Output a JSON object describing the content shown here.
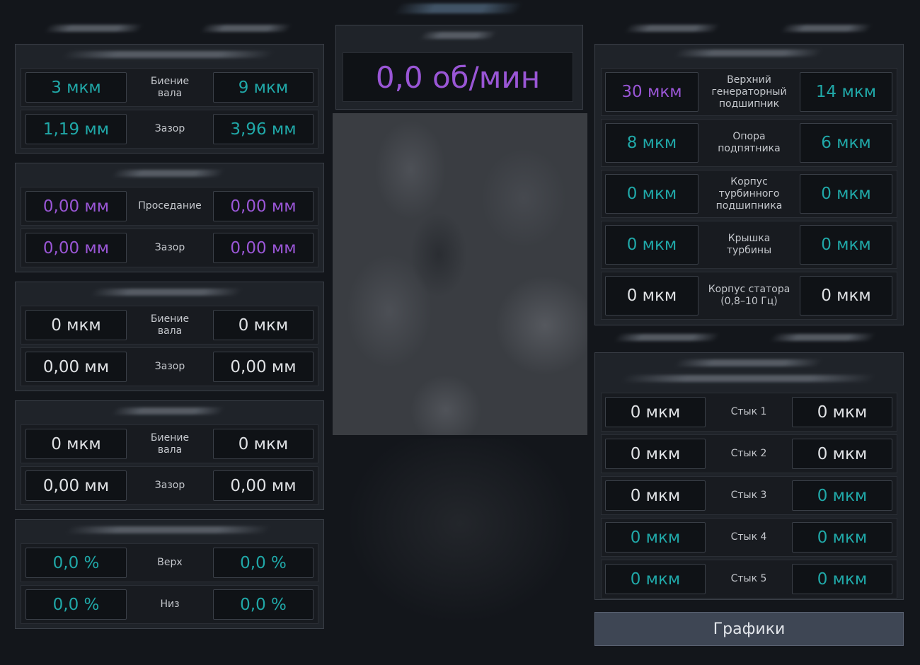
{
  "speed": {
    "value": "0,0 об/мин"
  },
  "left_panels": [
    {
      "rows": [
        {
          "left": "3 мкм",
          "label": "Биение\nвала",
          "right": "9 мкм"
        },
        {
          "left": "1,19 мм",
          "label": "Зазор",
          "right": "3,96 мм"
        }
      ]
    },
    {
      "rows": [
        {
          "left": "0,00 мм",
          "label": "Проседание",
          "right": "0,00 мм"
        },
        {
          "left": "0,00 мм",
          "label": "Зазор",
          "right": "0,00 мм"
        }
      ]
    },
    {
      "rows": [
        {
          "left": "0 мкм",
          "label": "Биение\nвала",
          "right": "0 мкм"
        },
        {
          "left": "0,00 мм",
          "label": "Зазор",
          "right": "0,00 мм"
        }
      ]
    },
    {
      "rows": [
        {
          "left": "0 мкм",
          "label": "Биение\nвала",
          "right": "0 мкм"
        },
        {
          "left": "0,00 мм",
          "label": "Зазор",
          "right": "0,00 мм"
        }
      ]
    },
    {
      "rows": [
        {
          "left": "0,0 %",
          "label": "Верх",
          "right": "0,0 %"
        },
        {
          "left": "0,0 %",
          "label": "Низ",
          "right": "0,0 %"
        }
      ]
    }
  ],
  "bearings": [
    {
      "left": "30 мкм",
      "label": "Верхний\nгенераторный\nподшипник",
      "right": "14 мкм"
    },
    {
      "left": "8 мкм",
      "label": "Опора\nподпятника",
      "right": "6 мкм"
    },
    {
      "left": "0 мкм",
      "label": "Корпус\nтурбинного\nподшипника",
      "right": "0 мкм"
    },
    {
      "left": "0 мкм",
      "label": "Крышка\nтурбины",
      "right": "0 мкм"
    },
    {
      "left": "0 мкм",
      "label": "Корпус статора\n(0,8–10 Гц)",
      "right": "0 мкм"
    }
  ],
  "joints": [
    {
      "left": "0 мкм",
      "label": "Стык 1",
      "right": "0 мкм"
    },
    {
      "left": "0 мкм",
      "label": "Стык 2",
      "right": "0 мкм"
    },
    {
      "left": "0 мкм",
      "label": "Стык 3",
      "right": "0 мкм"
    },
    {
      "left": "0 мкм",
      "label": "Стык 4",
      "right": "0 мкм"
    },
    {
      "left": "0 мкм",
      "label": "Стык 5",
      "right": "0 мкм"
    }
  ],
  "graphs_button": "Графики",
  "colors": {
    "teal": "#20a8a8",
    "purple": "#9a56d6",
    "white": "#dfe1e4",
    "background": "#13161b"
  },
  "images": {
    "center": "turbine-image (pixelated)"
  }
}
